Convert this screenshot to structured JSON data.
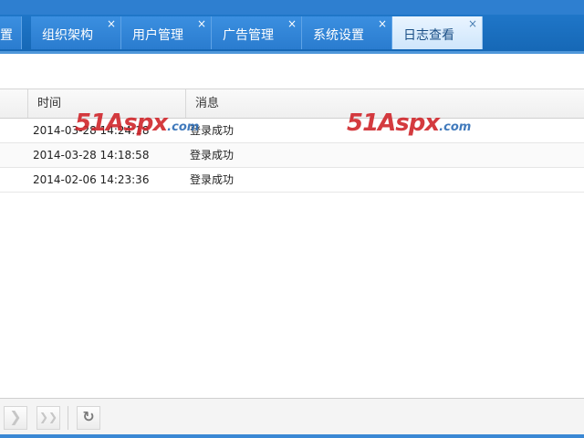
{
  "tabs": [
    {
      "label": "置",
      "active": false
    },
    {
      "label": "组织架构",
      "active": false
    },
    {
      "label": "用户管理",
      "active": false
    },
    {
      "label": "广告管理",
      "active": false
    },
    {
      "label": "系统设置",
      "active": false
    },
    {
      "label": "日志查看",
      "active": true
    }
  ],
  "close_glyph": "×",
  "grid": {
    "columns": [
      "时间",
      "消息"
    ],
    "rows": [
      {
        "time": "2014-03-28 14:24:18",
        "message": "登录成功"
      },
      {
        "time": "2014-03-28 14:18:58",
        "message": "登录成功"
      },
      {
        "time": "2014-02-06 14:23:36",
        "message": "登录成功"
      }
    ]
  },
  "watermark": {
    "big": "51Aspx",
    "small": ".com"
  },
  "pager": {
    "next_glyph": "❯",
    "last_glyph": "❯❯",
    "refresh_glyph": "↻"
  },
  "colors": {
    "tab_bar": "#1f76c8",
    "active_tab": "#e9f4ff",
    "watermark_red": "#d0262b",
    "watermark_blue": "#2d6cb5"
  }
}
